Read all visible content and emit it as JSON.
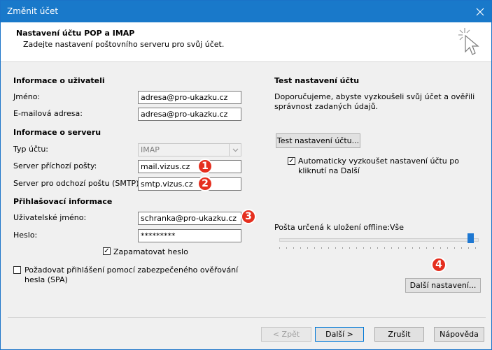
{
  "window": {
    "title": "Změnit účet"
  },
  "header": {
    "title": "Nastavení účtu POP a IMAP",
    "subtitle": "Zadejte nastavení poštovního serveru pro svůj účet."
  },
  "user_info": {
    "section": "Informace o uživateli",
    "name_label": "Jméno:",
    "name_value": "adresa@pro-ukazku.cz",
    "email_label": "E-mailová adresa:",
    "email_value": "adresa@pro-ukazku.cz"
  },
  "server_info": {
    "section": "Informace o serveru",
    "type_label": "Typ účtu:",
    "type_value": "IMAP",
    "incoming_label": "Server příchozí pošty:",
    "incoming_value": "mail.vizus.cz",
    "outgoing_label": "Server pro odchozí poštu (SMTP):",
    "outgoing_value": "smtp.vizus.cz"
  },
  "login_info": {
    "section": "Přihlašovací informace",
    "username_label": "Uživatelské jméno:",
    "username_value": "schranka@pro-ukazku.cz",
    "password_label": "Heslo:",
    "password_value": "*********",
    "remember_label": "Zapamatovat heslo",
    "remember_checked": true,
    "spa_label_line1": "Požadovat přihlášení pomocí zabezpečeného ověřování",
    "spa_label_line2": "hesla (SPA)",
    "spa_checked": false
  },
  "test_settings": {
    "section": "Test nastavení účtu",
    "desc_line1": "Doporučujeme, abyste vyzkoušeli svůj účet a ověřili",
    "desc_line2": "správnost zadaných údajů.",
    "test_button": "Test nastavení účtu...",
    "auto_test_line1": "Automaticky vyzkoušet nastavení účtu po",
    "auto_test_line2": "kliknutí na Další",
    "auto_test_checked": true
  },
  "offline": {
    "label": "Pošta určená k uložení offline:",
    "value": "Vše",
    "slider_level": 1.0
  },
  "more_settings_button": "Další nastavení...",
  "badges": [
    "1",
    "2",
    "3",
    "4"
  ],
  "footer": {
    "back": "< Zpět",
    "next": "Další >",
    "cancel": "Zrušit",
    "help": "Nápověda"
  },
  "colors": {
    "titlebar": "#1979ca",
    "badge": "#e52f1f",
    "accent": "#0078d7"
  }
}
